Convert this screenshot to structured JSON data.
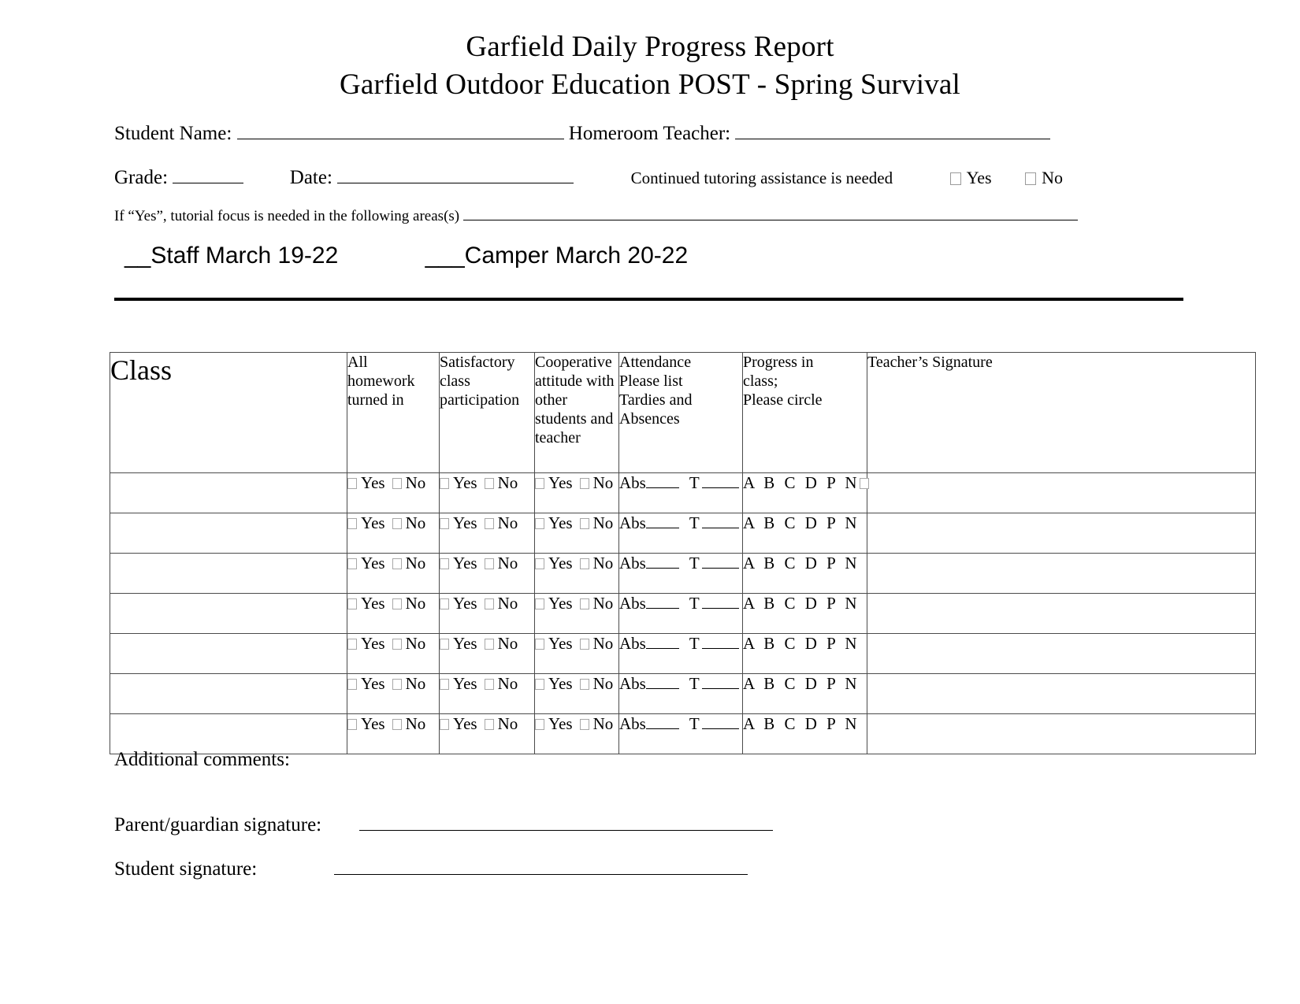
{
  "document": {
    "title_line_1": "Garfield Daily Progress Report",
    "title_line_2": "Garfield Outdoor Education POST - Spring Survival"
  },
  "header_form": {
    "student_name_label": "Student Name:",
    "student_name_value": "",
    "homeroom_teacher_label": "Homeroom Teacher:",
    "homeroom_teacher_value": "",
    "grade_label": "Grade:",
    "grade_value": "",
    "date_label": "Date:",
    "date_value": "",
    "tutoring_question": "Continued tutoring assistance is needed",
    "tutoring_yes_label": "Yes",
    "tutoring_no_label": "No",
    "if_yes_label": "If “Yes”, tutorial focus is needed in the following areas(s)",
    "if_yes_value": "",
    "session_staff": "__Staff  March 19-22",
    "session_camper": "___Camper  March 20-22"
  },
  "table": {
    "columns": [
      "Class",
      "All homework turned in",
      "Satisfactory class participation",
      "Cooperative attitude with other students and teacher",
      "Attendance Please list Tardies and Absences",
      "Progress in class; Please circle",
      "Teacher’s Signature"
    ],
    "headers": {
      "class": "Class",
      "homework": "All\nhomework\nturned in",
      "participation": "Satisfactory\nclass\nparticipation",
      "attitude": "Cooperative\nattitude with\nother\nstudents and\nteacher",
      "attendance": "Attendance\nPlease list\nTardies and\nAbsences",
      "progress": "Progress in\nclass;\nPlease circle",
      "signature": "Teacher’s Signature"
    },
    "cell_labels": {
      "yes": "Yes",
      "no": "No",
      "abs_prefix": "Abs",
      "tardy_letter": "T",
      "grades": "A B C D P N"
    },
    "rows": [
      {
        "class_value": "",
        "homework": "",
        "participation": "",
        "attitude": "",
        "attendance": "",
        "progress": "A B C D P N",
        "progress_extra_box": true,
        "progress_indent": 1,
        "signature": ""
      },
      {
        "class_value": "",
        "homework": "",
        "participation": "",
        "attitude": "",
        "attendance": "",
        "progress": "A B C D P N",
        "progress_extra_box": false,
        "progress_indent": 1,
        "signature": ""
      },
      {
        "class_value": "",
        "homework": "",
        "participation": "",
        "attitude": "",
        "attendance": "",
        "progress": "A B C D P N",
        "progress_extra_box": false,
        "progress_indent": 2,
        "signature": ""
      },
      {
        "class_value": "",
        "homework": "",
        "participation": "",
        "attitude": "",
        "attendance": "",
        "progress": "A B C D P N",
        "progress_extra_box": false,
        "progress_indent": 1,
        "signature": ""
      },
      {
        "class_value": "",
        "homework": "",
        "participation": "",
        "attitude": "",
        "attendance": "",
        "progress": "A B C D P N",
        "progress_extra_box": false,
        "progress_indent": 1,
        "signature": ""
      },
      {
        "class_value": "",
        "homework": "",
        "participation": "",
        "attitude": "",
        "attendance": "",
        "progress": "A B C D P N",
        "progress_extra_box": false,
        "progress_indent": 2,
        "signature": ""
      },
      {
        "class_value": "",
        "homework": "",
        "participation": "",
        "attitude": "",
        "attendance": "",
        "progress": "A B C D P N",
        "progress_extra_box": false,
        "progress_indent": 1,
        "signature": ""
      }
    ]
  },
  "footer": {
    "additional_comments_label": "Additional comments:",
    "additional_comments_value": "",
    "parent_signature_label": "Parent/guardian signature:",
    "parent_signature_value": "",
    "student_signature_label": "Student signature:",
    "student_signature_value": ""
  },
  "colors": {
    "text": "#000000",
    "page_background": "#ffffff",
    "table_border": "#4b4b4b",
    "rule": "#000000",
    "checkbox_border": "#9a9a9a"
  }
}
